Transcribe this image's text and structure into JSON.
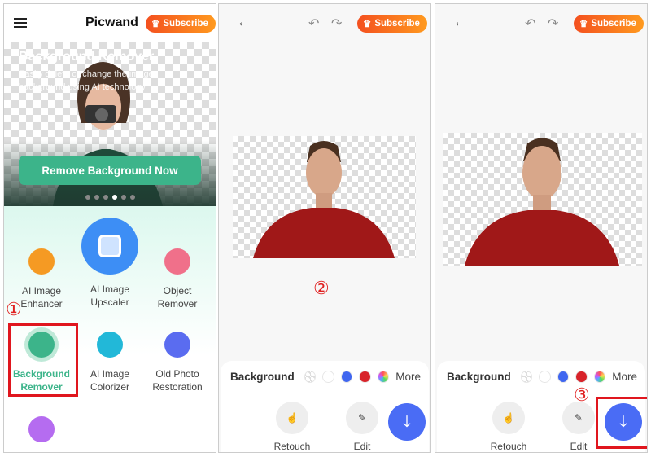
{
  "home": {
    "app_title": "Picwand",
    "subscribe_label": "Subscribe",
    "banner": {
      "title": "Background Remover",
      "subtitle_line1": "Easily delete or change the image",
      "subtitle_line2": "background using AI technology",
      "cta": "Remove Background Now",
      "active_dot": 4,
      "dot_count": 6
    },
    "tools": [
      {
        "line1": "AI Image",
        "line2": "Enhancer",
        "color": "#f59a23"
      },
      {
        "line1": "AI Image",
        "line2": "Upscaler",
        "color": "#3d8ef5"
      },
      {
        "line1": "Object",
        "line2": "Remover",
        "color": "#f0708a"
      },
      {
        "line1": "Background",
        "line2": "Remover",
        "color": "#3cb48a"
      },
      {
        "line1": "AI Image",
        "line2": "Colorizer",
        "color": "#22b8d8"
      },
      {
        "line1": "Old Photo",
        "line2": "Restoration",
        "color": "#5a6cf0"
      }
    ],
    "step": "①"
  },
  "editor": {
    "subscribe_label": "Subscribe",
    "background_label": "Background",
    "swatches": [
      "transparent",
      "#ffffff",
      "#3f66f0",
      "#d8232a",
      "rainbow"
    ],
    "more_label": "More",
    "retouch_label": "Retouch",
    "edit_label": "Edit",
    "step2": "②",
    "step3": "③"
  },
  "colors": {
    "accent_green": "#3cb48a",
    "download_blue": "#4a6cf5",
    "highlight_red": "#e0161e"
  }
}
